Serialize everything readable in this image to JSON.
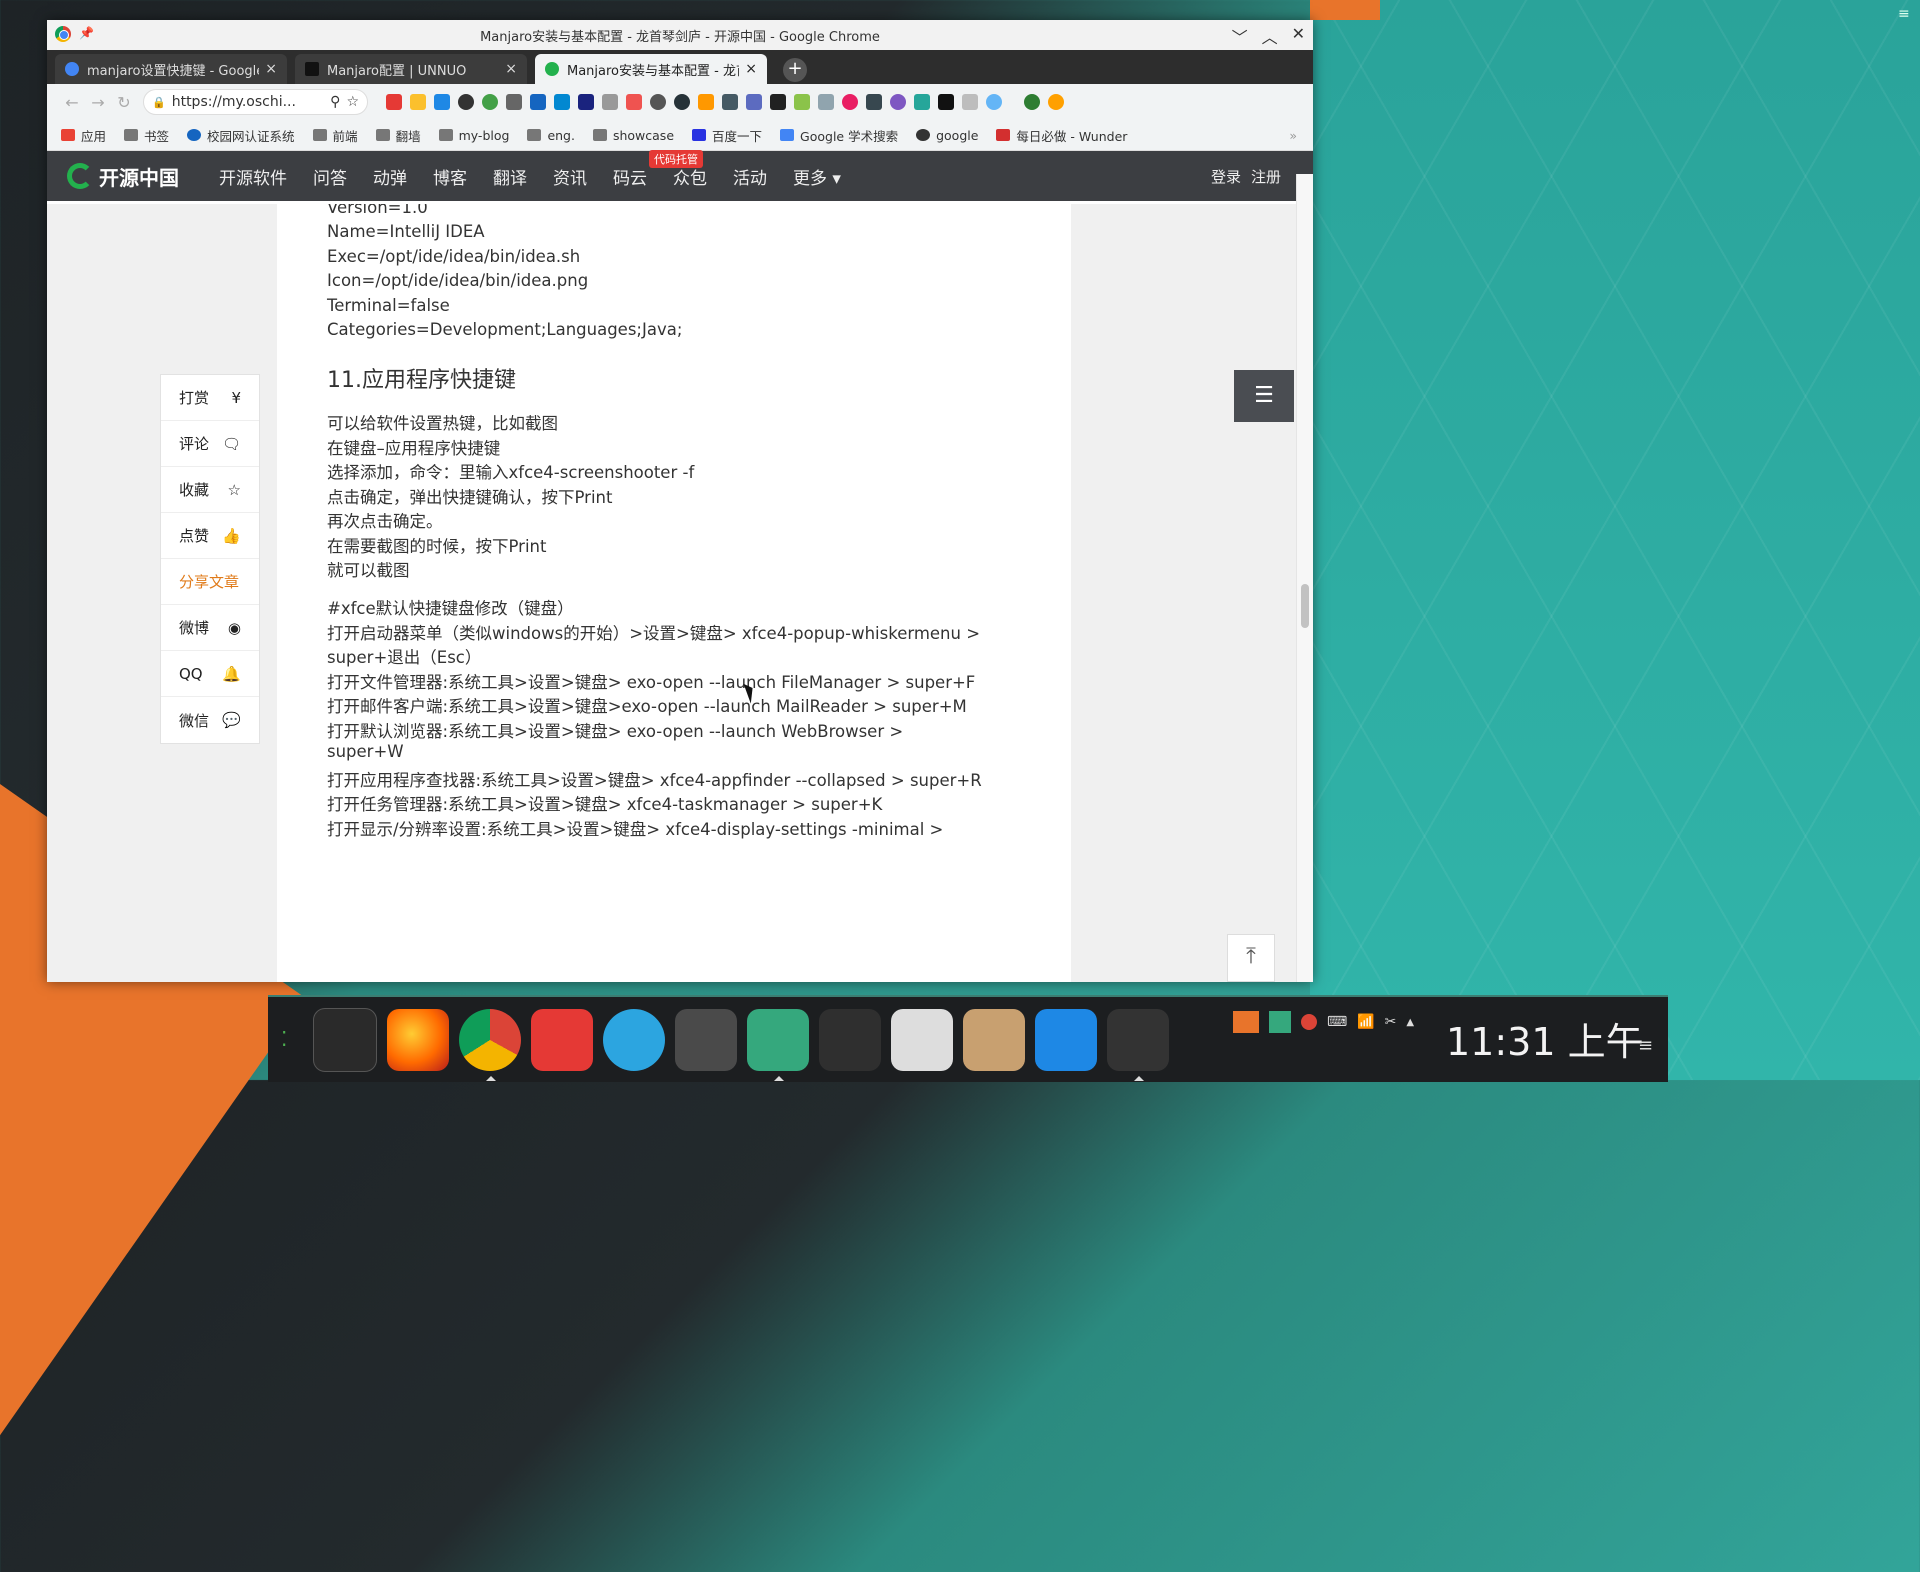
{
  "window": {
    "title": "Manjaro安装与基本配置 - 龙首琴剑庐 - 开源中国 - Google Chrome",
    "controls": [
      "﹀",
      "︿",
      "✕"
    ]
  },
  "tabs": [
    {
      "label": "manjaro设置快捷键 - Google",
      "close": "×",
      "active": false,
      "color": "#4285f4"
    },
    {
      "label": "Manjaro配置 | UNNUO",
      "close": "×",
      "active": false,
      "color": "#222222"
    },
    {
      "label": "Manjaro安装与基本配置 - 龙首",
      "close": "×",
      "active": true,
      "color": "#23b14d"
    }
  ],
  "newtab_label": "+",
  "toolbar": {
    "back": "←",
    "forward": "→",
    "reload": "↻",
    "url": "https://my.oschi...",
    "zoom_icon": "⚲",
    "star_icon": "☆"
  },
  "bookmarks": [
    {
      "label": "应用",
      "icon": "apps-icon"
    },
    {
      "label": "书签",
      "icon": "folder-icon"
    },
    {
      "label": "校园网认证系统",
      "icon": "site-icon"
    },
    {
      "label": "前端",
      "icon": "folder-icon"
    },
    {
      "label": "翻墙",
      "icon": "folder-icon"
    },
    {
      "label": "my-blog",
      "icon": "folder-icon"
    },
    {
      "label": "eng.",
      "icon": "folder-icon"
    },
    {
      "label": "showcase",
      "icon": "folder-icon"
    },
    {
      "label": "百度一下",
      "icon": "baidu-icon"
    },
    {
      "label": "Google 学术搜索",
      "icon": "scholar-icon"
    },
    {
      "label": "google",
      "icon": "site-icon"
    },
    {
      "label": "每日必做 - Wunder",
      "icon": "wunder-icon"
    }
  ],
  "bookmarks_more": "»",
  "site": {
    "logo": "开源中国",
    "nav": [
      "开源软件",
      "问答",
      "动弹",
      "博客",
      "翻译",
      "资讯",
      "码云",
      "众包",
      "活动",
      "更多 ▾"
    ],
    "badge": "代码托管",
    "login": "登录",
    "register": "注册"
  },
  "article": {
    "lines_top": [
      "Version=1.0",
      "Name=IntelliJ IDEA",
      "Exec=/opt/ide/idea/bin/idea.sh",
      "Icon=/opt/ide/idea/bin/idea.png",
      "Terminal=false",
      "Categories=Development;Languages;Java;"
    ],
    "heading": "11.应用程序快捷键",
    "lines_mid": [
      "可以给软件设置热键，比如截图",
      "在键盘–应用程序快捷键",
      "选择添加，命令：里输入xfce4-screenshooter -f",
      "点击确定，弹出快捷键确认，按下Print",
      "再次点击确定。",
      "在需要截图的时候，按下Print",
      "就可以截图"
    ],
    "lines_bottom": [
      "#xfce默认快捷键盘修改（键盘）",
      "打开启动器菜单（类似windows的开始）>设置>键盘> xfce4-popup-whiskermenu  >",
      "super+退出（Esc）",
      "打开文件管理器:系统工具>设置>键盘> exo-open --launch FileManager  >  super+F",
      "打开邮件客户端:系统工具>设置>键盘>exo-open --launch MailReader  >  super+M",
      "打开默认浏览器:系统工具>设置>键盘> exo-open --launch WebBrowser    >",
      "super+W",
      "打开应用程序查找器:系统工具>设置>键盘> xfce4-appfinder --collapsed  > super+R",
      "打开任务管理器:系统工具>设置>键盘>  xfce4-taskmanager  > super+K",
      "打开显示/分辨率设置:系统工具>设置>键盘> xfce4-display-settings  -minimal  >"
    ]
  },
  "sidebar": [
    {
      "label": "打赏",
      "icon": "¥",
      "name": "reward"
    },
    {
      "label": "评论",
      "icon": "🗨",
      "name": "comment"
    },
    {
      "label": "收藏",
      "icon": "☆",
      "name": "favorite"
    },
    {
      "label": "点赞",
      "icon": "👍",
      "name": "like"
    },
    {
      "label": "分享文章",
      "icon": "",
      "name": "share"
    },
    {
      "label": "微博",
      "icon": "◉",
      "name": "weibo"
    },
    {
      "label": "QQ",
      "icon": "🔔",
      "name": "qq"
    },
    {
      "label": "微信",
      "icon": "💬",
      "name": "wechat"
    }
  ],
  "toc_icon": "☰",
  "totop_icon": "⤒",
  "taskbar": {
    "clock": "11:31 上午",
    "menu_icon": "≡",
    "tray_up": "▲"
  }
}
